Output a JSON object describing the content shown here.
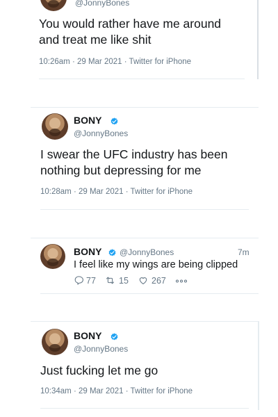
{
  "tweets": [
    {
      "handle": "@JonnyBones",
      "text": "You would rather have me around and treat me like shit",
      "meta": "10:26am · 29 Mar 2021 · Twitter for iPhone"
    },
    {
      "name": "BONY",
      "handle": "@JonnyBones",
      "text": "I swear the UFC industry has been nothing but depressing for me",
      "meta": "10:28am · 29 Mar 2021 · Twitter for iPhone"
    },
    {
      "name": "BONY",
      "handle": "@JonnyBones",
      "time": "7m",
      "text": "I feel like my wings are being clipped",
      "replies": "77",
      "retweets": "15",
      "likes": "267"
    },
    {
      "name": "BONY",
      "handle": "@JonnyBones",
      "text": "Just fucking let me go",
      "meta": "10:34am · 29 Mar 2021 · Twitter for iPhone"
    }
  ],
  "colors": {
    "verified": "#1da1f2",
    "secondary": "#657786",
    "divider": "#e6ecf0"
  }
}
